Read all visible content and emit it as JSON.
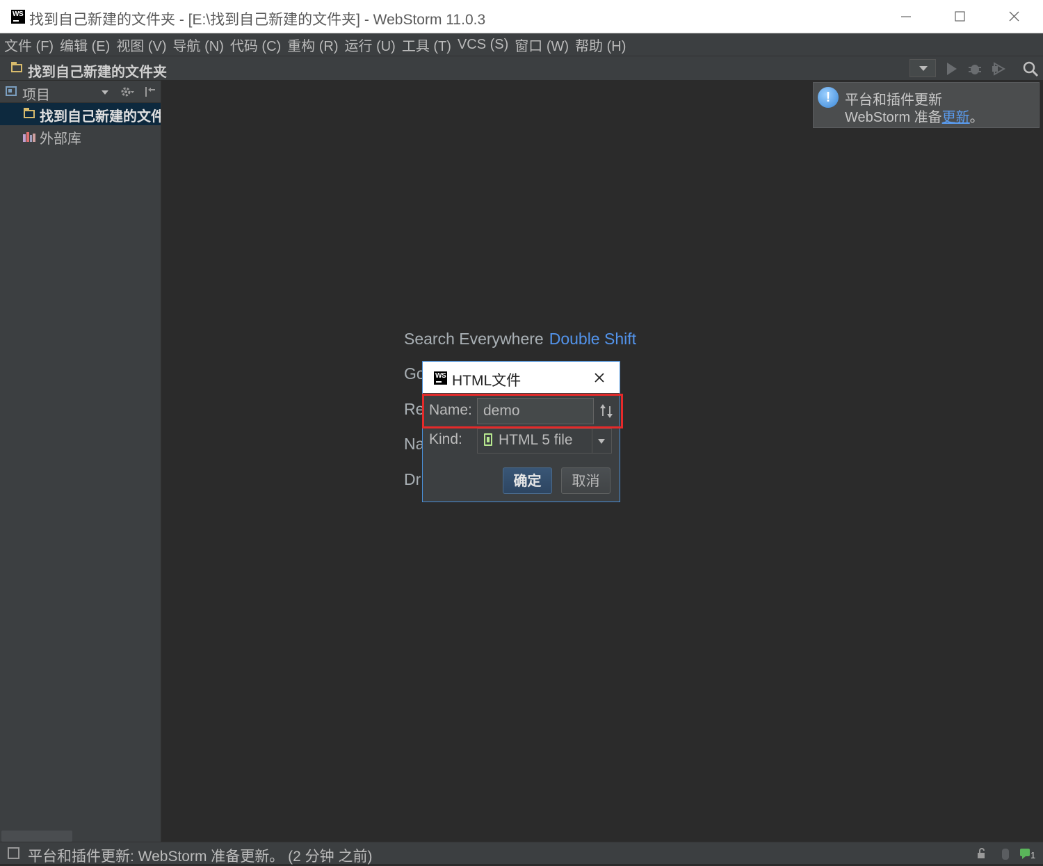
{
  "window": {
    "title": "找到自己新建的文件夹 - [E:\\找到自己新建的文件夹] - WebStorm 11.0.3",
    "logo": "WS"
  },
  "menu": [
    "文件 (F)",
    "编辑 (E)",
    "视图 (V)",
    "导航 (N)",
    "代码 (C)",
    "重构 (R)",
    "运行 (U)",
    "工具 (T)",
    "VCS (S)",
    "窗口 (W)",
    "帮助 (H)"
  ],
  "navbar": {
    "project_name": "找到自己新建的文件夹"
  },
  "sidebar": {
    "title": "项目",
    "items": [
      {
        "label": "找到自己新建的文件夹",
        "icon": "folder-icon",
        "selected": true
      },
      {
        "label": "外部库",
        "icon": "library-icon",
        "selected": false
      }
    ]
  },
  "hints": {
    "search_label": "Search Everywhere",
    "search_key": "Double Shift",
    "partial": [
      "Go",
      "Re",
      "Na",
      "Dr"
    ]
  },
  "notification": {
    "title": "平台和插件更新",
    "body_prefix": "WebStorm 准备",
    "link": "更新",
    "body_suffix": "。"
  },
  "dialog": {
    "title": "HTML文件",
    "logo": "WS",
    "name_label": "Name:",
    "name_value": "demo",
    "kind_label": "Kind:",
    "kind_value": "HTML 5 file",
    "ok_label": "确定",
    "cancel_label": "取消"
  },
  "status": {
    "text": "平台和插件更新: WebStorm 准备更新。 (2 分钟 之前)",
    "event_count": "1"
  },
  "colors": {
    "background": "#2b2b2b",
    "panel": "#3c3f41",
    "link": "#5394ec",
    "highlight": "#e52a2a"
  }
}
